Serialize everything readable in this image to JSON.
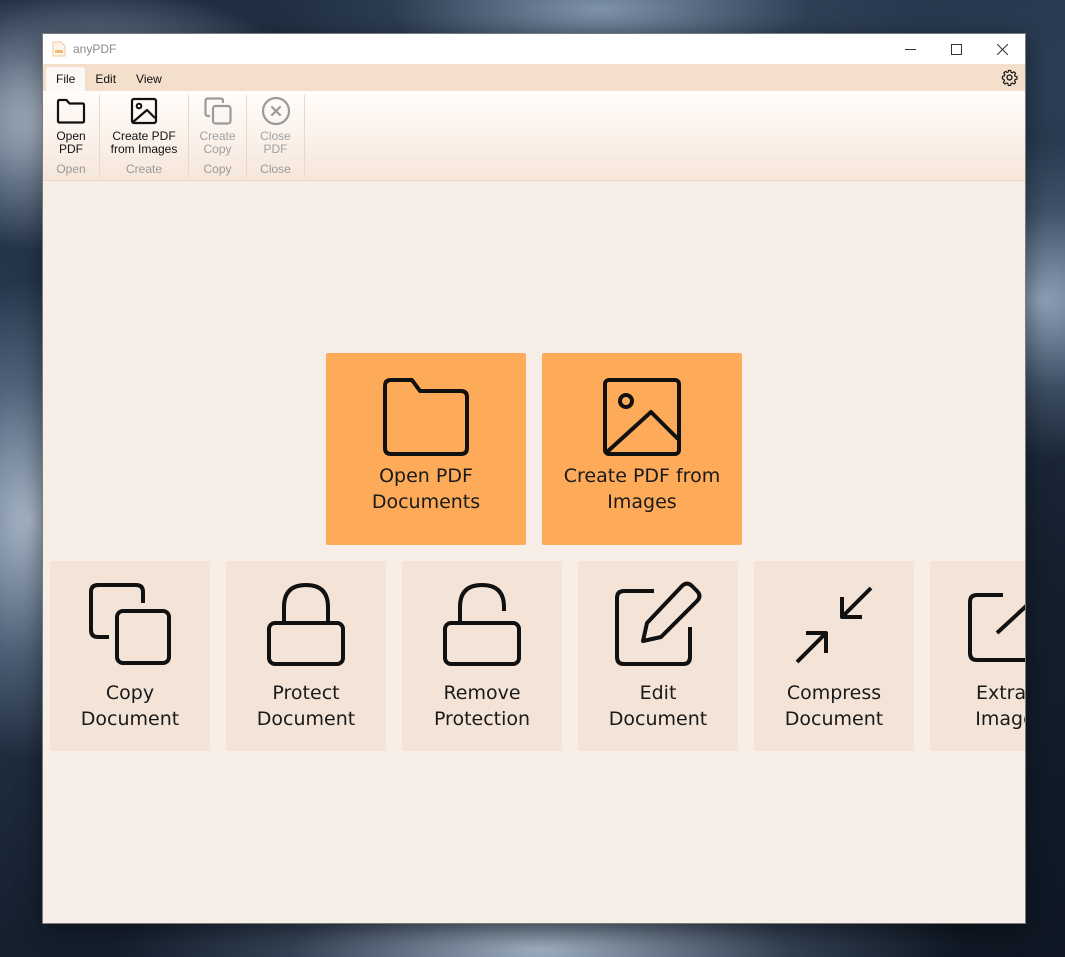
{
  "window": {
    "title": "anyPDF"
  },
  "menu": {
    "tabs": [
      "File",
      "Edit",
      "View"
    ],
    "active_tab": "File"
  },
  "ribbon": {
    "groups": [
      {
        "button": "Open\nPDF",
        "group": "Open",
        "enabled": true,
        "icon": "folder-icon"
      },
      {
        "button": "Create PDF\nfrom Images",
        "group": "Create",
        "enabled": true,
        "icon": "image-icon"
      },
      {
        "button": "Create\nCopy",
        "group": "Copy",
        "enabled": false,
        "icon": "copy-icon"
      },
      {
        "button": "Close\nPDF",
        "group": "Close",
        "enabled": false,
        "icon": "close-circle-icon"
      }
    ]
  },
  "primary_tiles": [
    {
      "label": "Open PDF\nDocuments",
      "icon": "folder-icon"
    },
    {
      "label": "Create PDF from\nImages",
      "icon": "image-icon"
    }
  ],
  "secondary_tiles": [
    {
      "label": "Copy\nDocument",
      "icon": "copy-icon"
    },
    {
      "label": "Protect\nDocument",
      "icon": "lock-icon"
    },
    {
      "label": "Remove\nProtection",
      "icon": "unlock-icon"
    },
    {
      "label": "Edit\nDocument",
      "icon": "edit-icon"
    },
    {
      "label": "Compress\nDocument",
      "icon": "compress-icon"
    },
    {
      "label": "Extract\nImages",
      "icon": "extract-icon"
    }
  ],
  "colors": {
    "accent_tile": "#fdab58",
    "secondary_tile": "#f4e4d7",
    "background": "#f8eee8",
    "menubar": "#f3dfcc"
  }
}
